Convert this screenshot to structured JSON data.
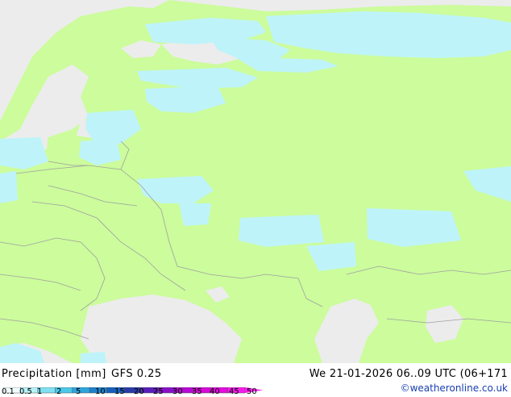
{
  "footer": {
    "title": "Precipitation [mm]",
    "model": "GFS 0.25",
    "datetime": "We 21-01-2026 06..09 UTC (06+171",
    "credit": "©weatheronline.co.uk"
  },
  "legend": {
    "ticks": [
      "0.1",
      "0.5",
      "1",
      "2",
      "5",
      "10",
      "15",
      "20",
      "25",
      "30",
      "35",
      "40",
      "45",
      "50"
    ],
    "colors": [
      "#f0fcfc",
      "#b6f2f8",
      "#7fe0f2",
      "#4cc8ea",
      "#2ea4dc",
      "#1c82cc",
      "#1560bc",
      "#2a3aa8",
      "#5a1eb8",
      "#8a10c8",
      "#b80ad4",
      "#d60ad8",
      "#e60ae0",
      "#f41cea"
    ]
  },
  "map": {
    "land_color": "#ccfc9c",
    "sea_color": "#ececec",
    "precip_color": "#bef4f9",
    "border_color": "#a0a0a0"
  }
}
